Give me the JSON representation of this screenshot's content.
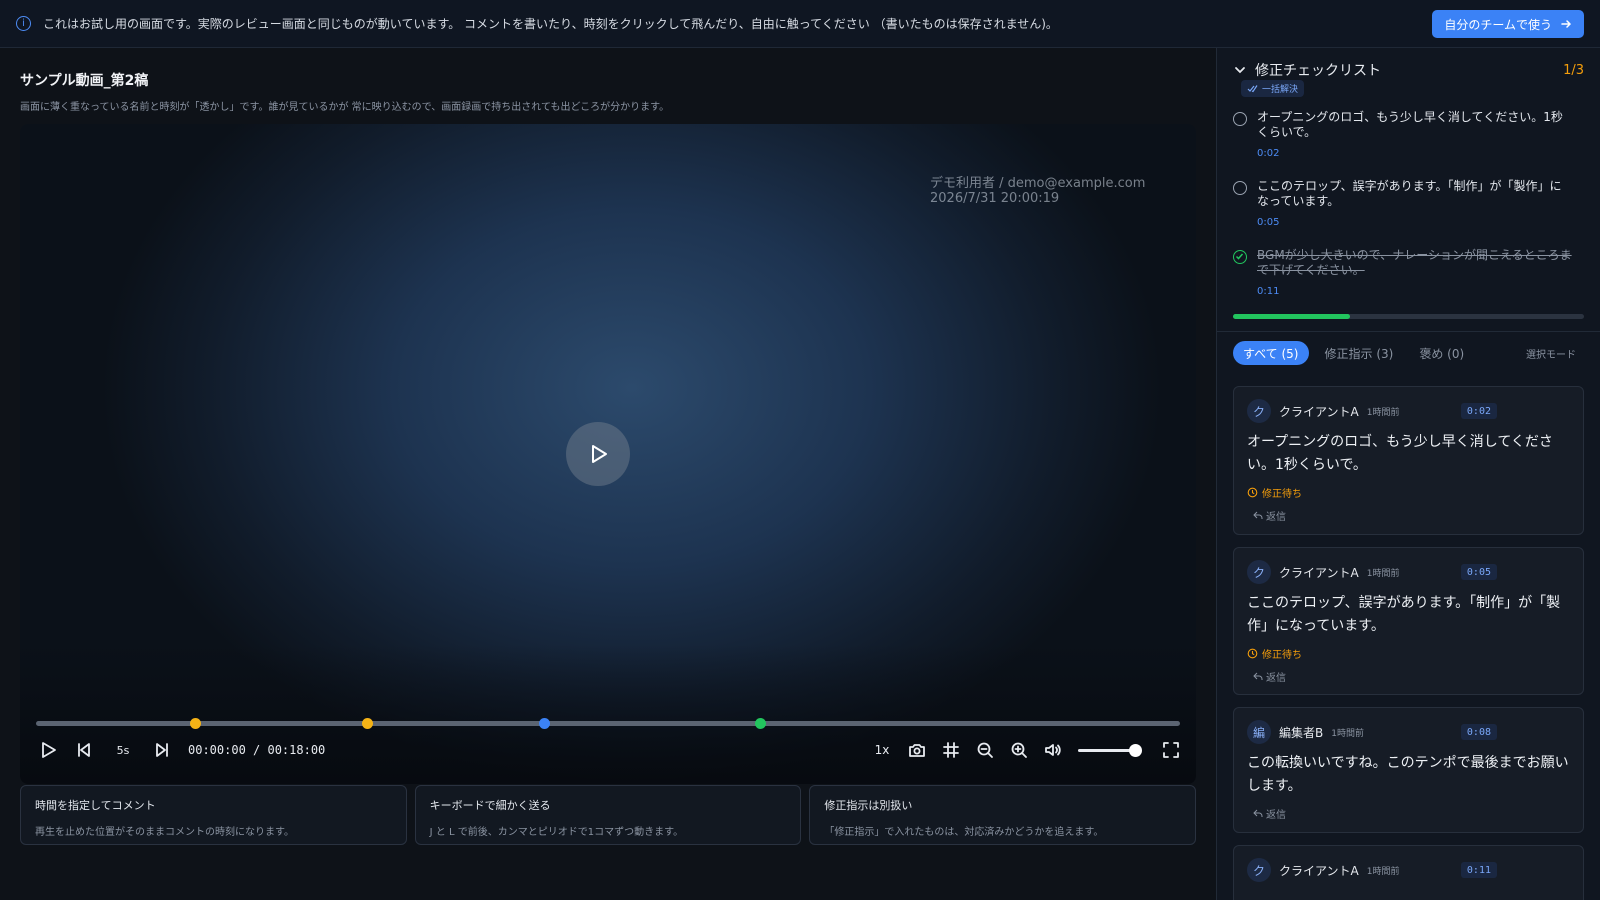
{
  "banner": {
    "message": "これはお試し用の画面です。実際のレビュー画面と同じものが動いています。 コメントを書いたり、時刻をクリックして飛んだり、自由に触ってください （書いたものは保存されません)。",
    "cta_label": "自分のチームで使う"
  },
  "video": {
    "title": "サンプル動画_第2稿",
    "subtitle": "画面に薄く重なっている名前と時刻が「透かし」です。誰が見ているかが 常に映り込むので、画面録画で持ち出されても出どころが分かります。",
    "watermark_user": "デモ利用者 / demo@example.com",
    "watermark_time": "2026/7/31 20:00:19",
    "skip_label": "5s",
    "current_time": "00:00:00",
    "duration": "00:18:00",
    "speed": "1x",
    "volume": 1.0,
    "markers": [
      {
        "position": 0.139,
        "color": "#f5b316"
      },
      {
        "position": 0.289,
        "color": "#f5b316"
      },
      {
        "position": 0.444,
        "color": "#3b82f6"
      },
      {
        "position": 0.633,
        "color": "#22c55e"
      }
    ]
  },
  "hints": [
    {
      "title": "時間を指定してコメント",
      "text": "再生を止めた位置がそのままコメントの時刻になります。"
    },
    {
      "title": "キーボードで細かく送る",
      "text": "J と L で前後、カンマとピリオドで1コマずつ動きます。"
    },
    {
      "title": "修正指示は別扱い",
      "text": "「修正指示」で入れたものは、対応済みかどうかを追えます。"
    }
  ],
  "checklist": {
    "title": "修正チェックリスト",
    "count": "1/3",
    "resolve_all_label": "一括解決",
    "progress": 0.333,
    "items": [
      {
        "text": "オープニングのロゴ、もう少し早く消してください。1秒くらいで。",
        "time": "0:02",
        "done": false
      },
      {
        "text": "ここのテロップ、誤字があります。「制作」が「製作」になっています。",
        "time": "0:05",
        "done": false
      },
      {
        "text": "BGMが少し大きいので、ナレーションが聞こえるところまで下げてください。",
        "time": "0:11",
        "done": true
      }
    ]
  },
  "tabs": {
    "all": "すべて (5)",
    "fixes": "修正指示 (3)",
    "praise": "褒め (0)",
    "select_mode": "選択モード"
  },
  "comments": [
    {
      "avatar": "ク",
      "author": "クライアントA",
      "ago": "1時間前",
      "time": "0:02",
      "body": "オープニングのロゴ、もう少し早く消してください。1秒くらいで。",
      "status": "修正待ち",
      "reply": "返信"
    },
    {
      "avatar": "ク",
      "author": "クライアントA",
      "ago": "1時間前",
      "time": "0:05",
      "body": "ここのテロップ、誤字があります。「制作」が「製作」になっています。",
      "status": "修正待ち",
      "reply": "返信"
    },
    {
      "avatar": "編",
      "author": "編集者B",
      "ago": "1時間前",
      "time": "0:08",
      "body": "この転換いいですね。このテンポで最後までお願いします。",
      "status": "",
      "reply": "返信"
    },
    {
      "avatar": "ク",
      "author": "クライアントA",
      "ago": "1時間前",
      "time": "0:11",
      "body": "",
      "status": "",
      "reply": ""
    }
  ]
}
